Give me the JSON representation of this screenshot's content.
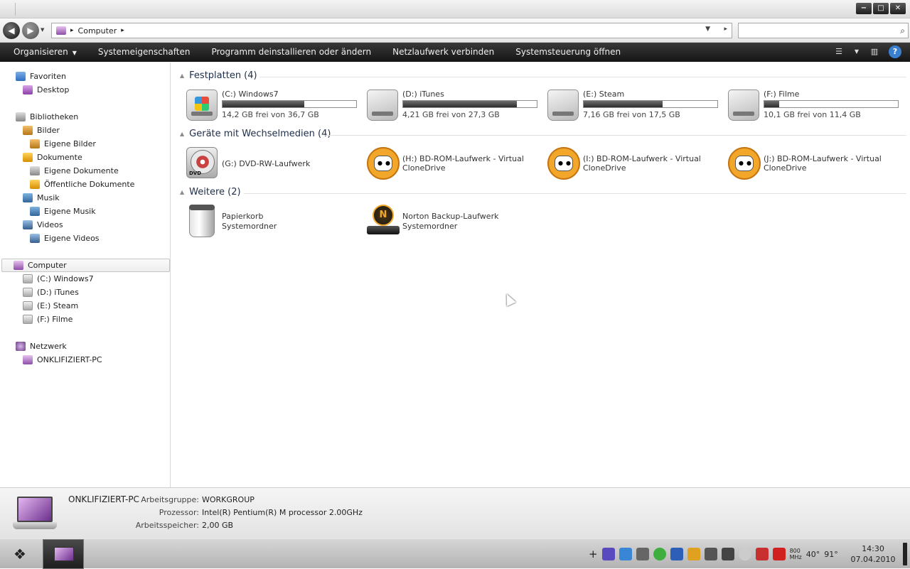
{
  "window": {
    "minimize_label": "−",
    "maximize_label": "□",
    "close_label": "✕"
  },
  "nav_buttons": {
    "back": "◀",
    "forward": "▶"
  },
  "address": {
    "root_icon": "computer-icon",
    "sep": "▸",
    "path": "Computer",
    "dropdown": "▼",
    "go": "▸"
  },
  "search": {
    "placeholder": "",
    "value": "",
    "icon": "⌕"
  },
  "toolbar": {
    "organize": "Organisieren",
    "organize_dd": "▼",
    "sysprops": "Systemeigenschaften",
    "uninstall": "Programm deinstallieren oder ändern",
    "mapdrive": "Netzlaufwerk verbinden",
    "controlpanel": "Systemsteuerung öffnen",
    "views_icon": "☰",
    "views_dd": "▼",
    "preview_icon": "▥",
    "help": "?"
  },
  "nav": {
    "favorites": "Favoriten",
    "desktop": "Desktop",
    "libraries": "Bibliotheken",
    "pictures": "Bilder",
    "my_pictures": "Eigene Bilder",
    "documents": "Dokumente",
    "my_documents": "Eigene Dokumente",
    "public_documents": "Öffentliche Dokumente",
    "music": "Musik",
    "my_music": "Eigene Musik",
    "videos": "Videos",
    "my_videos": "Eigene Videos",
    "computer": "Computer",
    "drive_c": "(C:) Windows7",
    "drive_d": "(D:) iTunes",
    "drive_e": "(E:) Steam",
    "drive_f": "(F:) Filme",
    "network": "Netzwerk",
    "pc": "ONKLIFIZIERT-PC"
  },
  "groups": {
    "hdd": "Festplatten (4)",
    "removable": "Geräte mit Wechselmedien (4)",
    "other": "Weitere (2)"
  },
  "drives": [
    {
      "name": "(C:) Windows7",
      "free": "14,2 GB frei von 36,7 GB",
      "used_fraction": 0.61
    },
    {
      "name": "(D:) iTunes",
      "free": "4,21 GB frei von 27,3 GB",
      "used_fraction": 0.85
    },
    {
      "name": "(E:) Steam",
      "free": "7,16 GB frei von 17,5 GB",
      "used_fraction": 0.59
    },
    {
      "name": "(F:) Filme",
      "free": "10,1 GB frei von 11,4 GB",
      "used_fraction": 0.11
    }
  ],
  "removable": [
    {
      "line1": "(G:) DVD-RW-Laufwerk",
      "line2": "",
      "disc_label": "DVD"
    },
    {
      "line1": "(H:) BD-ROM-Laufwerk - Virtual",
      "line2": "CloneDrive"
    },
    {
      "line1": "(I:) BD-ROM-Laufwerk - Virtual",
      "line2": "CloneDrive"
    },
    {
      "line1": "(J:) BD-ROM-Laufwerk - Virtual",
      "line2": "CloneDrive"
    }
  ],
  "other": [
    {
      "line1": "Papierkorb",
      "line2": "Systemordner"
    },
    {
      "line1": "Norton Backup-Laufwerk",
      "line2": "Systemordner",
      "glyph": "N"
    }
  ],
  "details": {
    "name": "ONKLIFIZIERT-PC",
    "workgroup_label": "Arbeitsgruppe:",
    "workgroup": "WORKGROUP",
    "cpu_label": "Prozessor:",
    "cpu": "Intel(R) Pentium(R) M processor 2.00GHz",
    "ram_label": "Arbeitsspeicher:",
    "ram": "2,00 GB"
  },
  "taskbar": {
    "start_icon": "❖",
    "tray_add": "+",
    "tray_800": "800",
    "tray_mhz": "MHz",
    "temp1": "40°",
    "temp2": "91°",
    "time": "14:30",
    "date": "07.04.2010",
    "tray_icons": [
      "paw-icon",
      "ie-icon",
      "tools-icon",
      "chrome-icon",
      "lock-icon",
      "users-icon",
      "camera-icon",
      "network-icon",
      "disc-icon",
      "devil-icon",
      "ati-icon"
    ]
  }
}
